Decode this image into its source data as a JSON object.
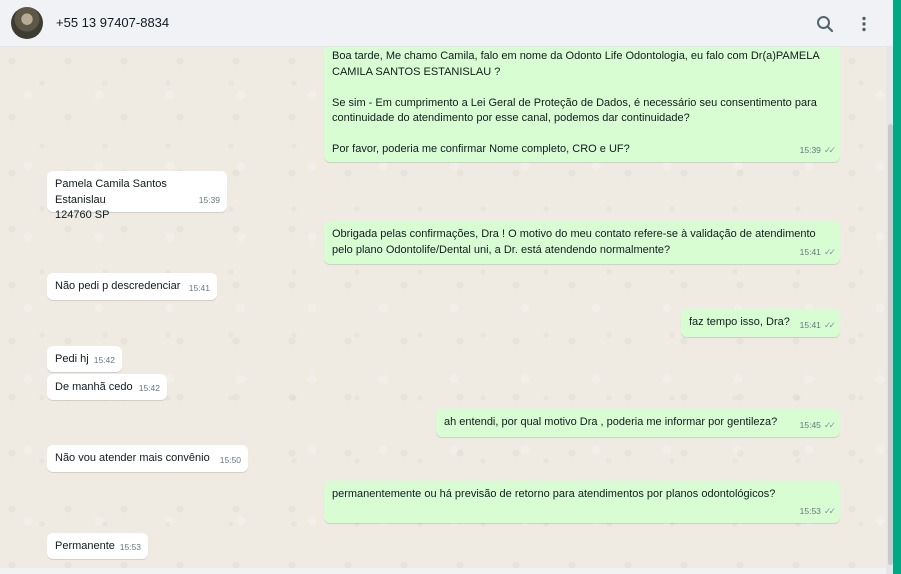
{
  "header": {
    "contact_name": "+55 13 97407-8834"
  },
  "messages": [
    {
      "direction": "out",
      "text": "Boa tarde, Me chamo Camila, falo em nome da Odonto Life Odontologia, eu falo com Dr(a)PAMELA CAMILA SANTOS ESTANISLAU ?\n\nSe sim - Em cumprimento a Lei Geral de Proteção de Dados, é necessário seu consentimento para continuidade do atendimento por esse canal, podemos dar continuidade?\n\nPor favor, poderia me confirmar Nome completo, CRO e UF?",
      "time": "15:39"
    },
    {
      "direction": "in",
      "text": "Pamela Camila Santos Estanislau\n124760 SP",
      "time": "15:39"
    },
    {
      "direction": "out",
      "text": "Obrigada pelas confirmações, Dra ! O motivo do meu contato refere-se à validação de atendimento pelo plano Odontolife/Dental uni, a Dr. está atendendo normalmente?",
      "time": "15:41"
    },
    {
      "direction": "in",
      "text": "Não pedi p descredenciar",
      "time": "15:41"
    },
    {
      "direction": "out",
      "text": "faz tempo isso, Dra?",
      "time": "15:41"
    },
    {
      "direction": "in",
      "text": "Pedi hj",
      "time": "15:42"
    },
    {
      "direction": "in",
      "text": "De manhã cedo",
      "time": "15:42"
    },
    {
      "direction": "out",
      "text": "ah entendi, por qual motivo Dra , poderia me informar por gentileza?",
      "time": "15:45"
    },
    {
      "direction": "in",
      "text": "Não vou atender mais convênio",
      "time": "15:50"
    },
    {
      "direction": "out",
      "text": "permanentemente ou há previsão de retorno para atendimentos por planos odontológicos?",
      "time": "15:53"
    },
    {
      "direction": "in",
      "text": "Permanente",
      "time": "15:53"
    }
  ],
  "icons": {
    "search": "search-icon",
    "menu": "kebab-menu-icon",
    "read_receipt": "double-check-icon"
  },
  "colors": {
    "incoming_bubble": "#ffffff",
    "outgoing_bubble": "#d9fdd3",
    "header": "#f0f2f5",
    "background": "#efeae2",
    "accent": "#00a884"
  }
}
